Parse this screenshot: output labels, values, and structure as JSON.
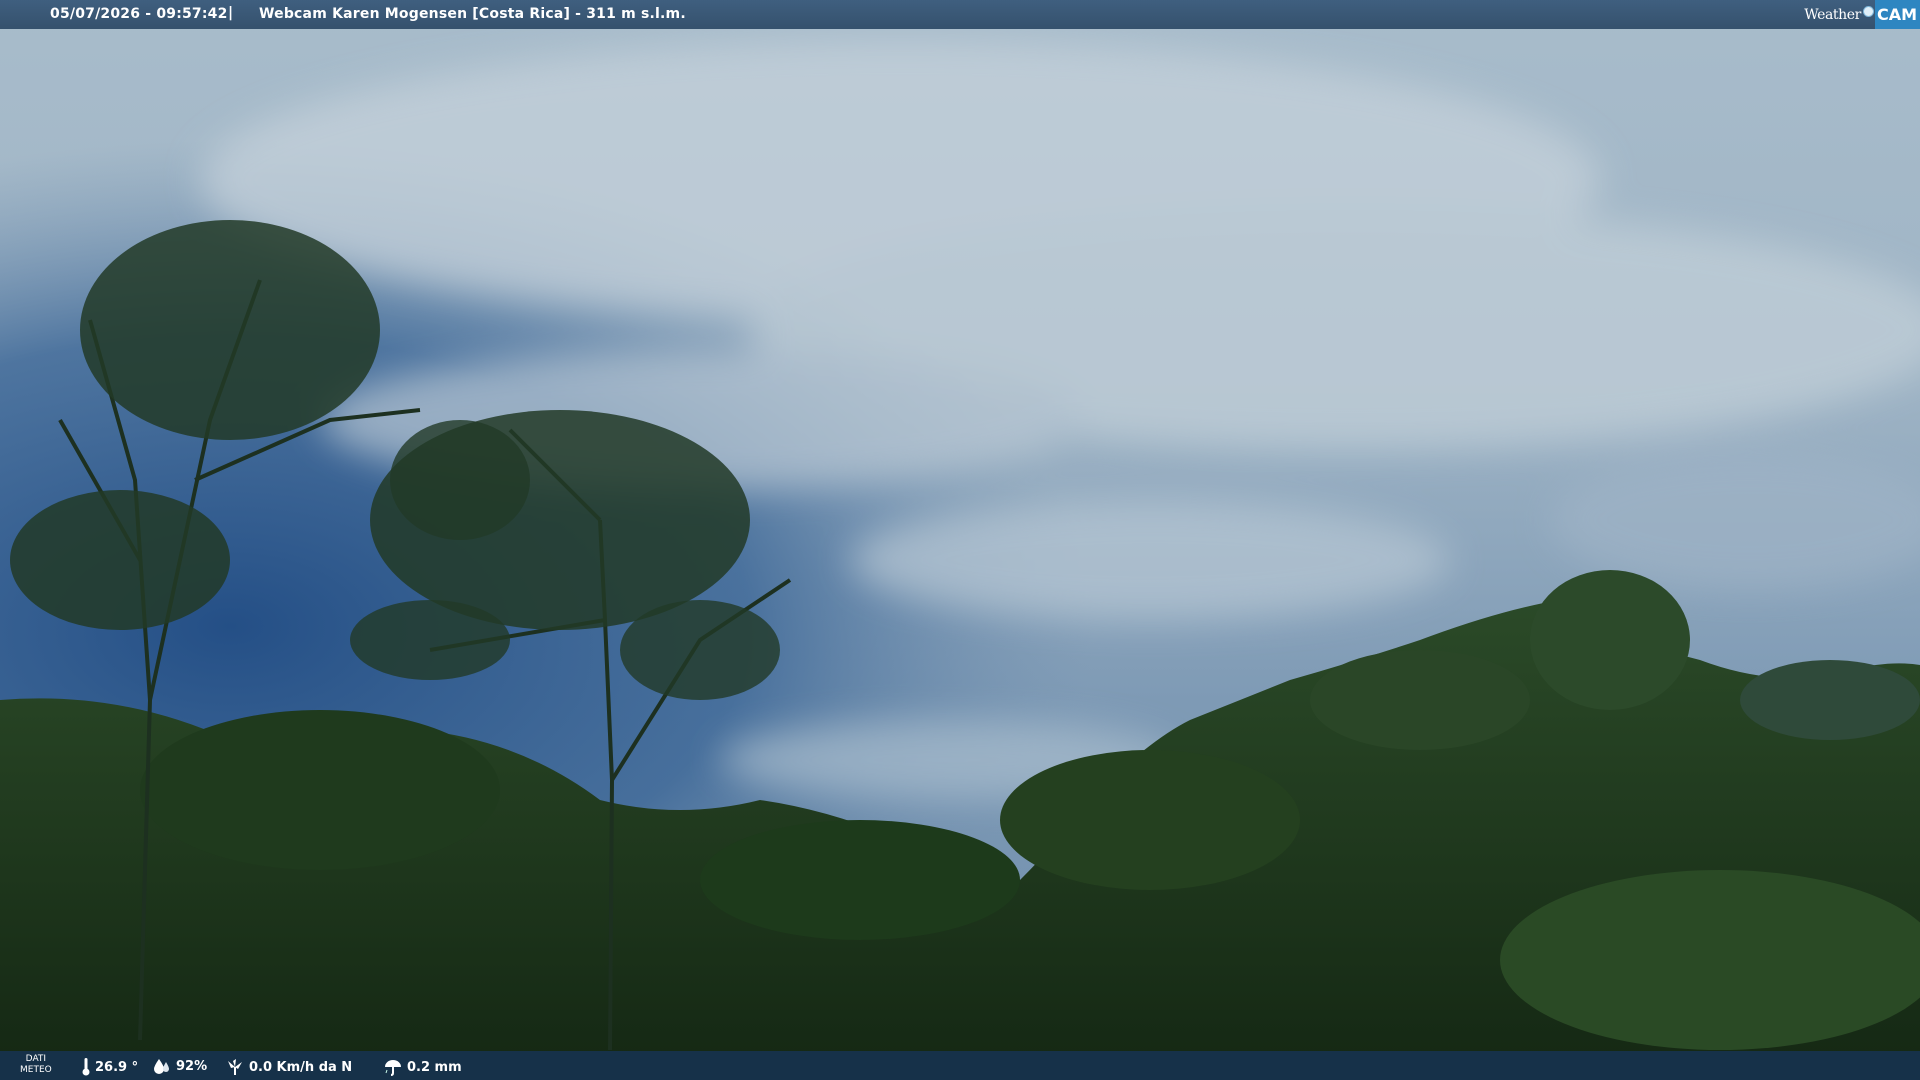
{
  "header": {
    "datetime": "05/07/2026 - 09:57:42",
    "separator": "|",
    "title": "Webcam Karen Mogensen [Costa Rica]  - 311 m s.l.m.",
    "brand_left": "Weather",
    "brand_right": "CAM"
  },
  "footer": {
    "label_line1": "DATI",
    "label_line2": "METEO",
    "temperature": "26.9 °",
    "humidity": "92%",
    "wind": "0.0 Km/h da N",
    "rain": "0.2 mm",
    "icons": [
      "thermometer-icon",
      "humidity-icon",
      "wind-icon",
      "rain-icon"
    ]
  },
  "colors": {
    "sky_top": "#a9bccb",
    "sky_blue": "#2f5a8e",
    "foliage": "#1e3a1c",
    "bar": "#17324e",
    "brand_accent": "#2e86c1"
  }
}
